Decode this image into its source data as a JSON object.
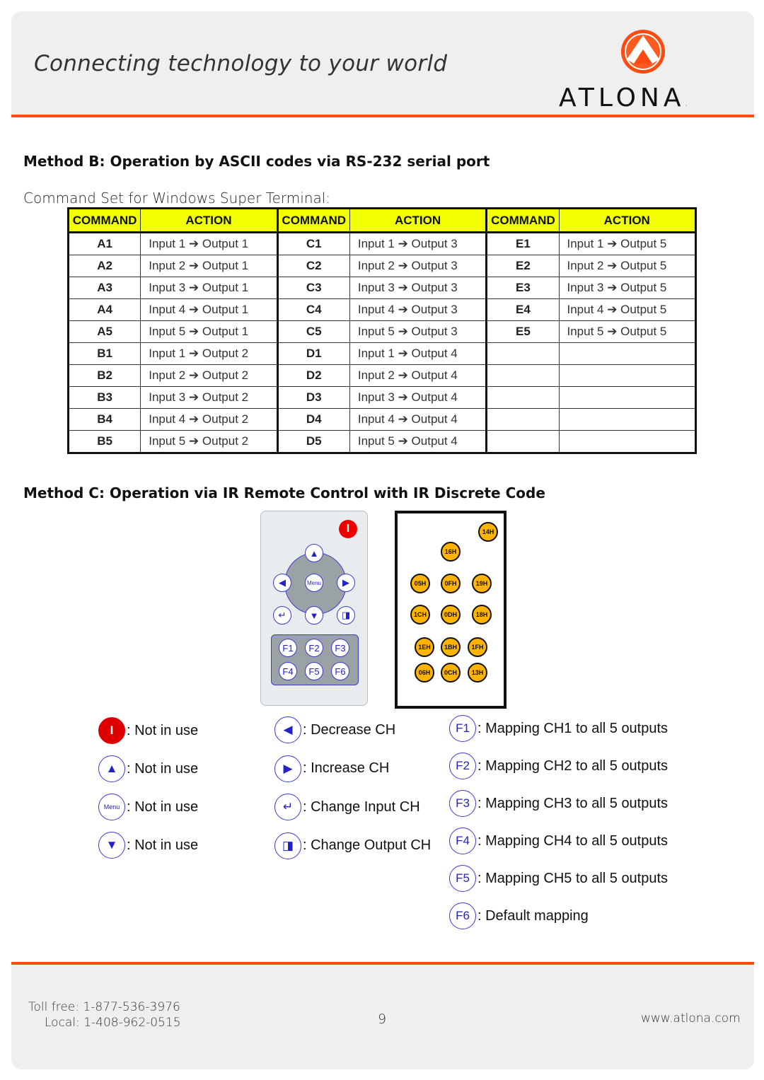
{
  "header": {
    "tagline": "Connecting technology to your world",
    "brand": "ATLONA",
    "brand_suffix": ".",
    "accent_color": "#ff4a12"
  },
  "method_b": {
    "title": "Method B: Operation by ASCII codes via RS-232 serial port",
    "subtitle": "Command Set for Windows Super Terminal:",
    "headers": [
      "COMMAND",
      "ACTION",
      "COMMAND",
      "ACTION",
      "COMMAND",
      "ACTION"
    ],
    "rows": [
      [
        "A1",
        "Input 1 ➔ Output 1",
        "C1",
        "Input 1 ➔ Output 3",
        "E1",
        "Input 1 ➔ Output 5"
      ],
      [
        "A2",
        "Input 2 ➔ Output 1",
        "C2",
        "Input 2 ➔ Output 3",
        "E2",
        "Input 2 ➔ Output 5"
      ],
      [
        "A3",
        "Input 3 ➔ Output 1",
        "C3",
        "Input 3 ➔ Output 3",
        "E3",
        "Input 3 ➔ Output 5"
      ],
      [
        "A4",
        "Input 4 ➔ Output 1",
        "C4",
        "Input 4 ➔ Output 3",
        "E4",
        "Input 4 ➔ Output 5"
      ],
      [
        "A5",
        "Input 5 ➔ Output 1",
        "C5",
        "Input 5 ➔ Output 3",
        "E5",
        "Input 5 ➔ Output 5"
      ],
      [
        "B1",
        "Input 1 ➔ Output 2",
        "D1",
        "Input 1 ➔ Output 4",
        "",
        ""
      ],
      [
        "B2",
        "Input 2 ➔ Output 2",
        "D2",
        "Input 2 ➔ Output 4",
        "",
        ""
      ],
      [
        "B3",
        "Input 3 ➔ Output 2",
        "D3",
        "Input 3 ➔ Output 4",
        "",
        ""
      ],
      [
        "B4",
        "Input 4 ➔ Output 2",
        "D4",
        "Input 4 ➔ Output 4",
        "",
        ""
      ],
      [
        "B5",
        "Input 5 ➔ Output 2",
        "D5",
        "Input 5 ➔ Output 4",
        "",
        ""
      ]
    ],
    "header_color": "#f2ff00"
  },
  "method_c": {
    "title": "Method C: Operation via IR Remote Control with IR Discrete Code",
    "remote_buttons": {
      "power": "I",
      "menu": "Menu",
      "f_keys": [
        "F1",
        "F2",
        "F3",
        "F4",
        "F5",
        "F6"
      ]
    },
    "ir_codes": [
      "14H",
      "16H",
      "05H",
      "0FH",
      "19H",
      "1CH",
      "0DH",
      "18H",
      "1EH",
      "1BH",
      "1FH",
      "06H",
      "0CH",
      "13H"
    ],
    "legend_left": [
      {
        "icon": "power-icon",
        "glyph": "I",
        "label": ": Not in use"
      },
      {
        "icon": "up-arrow-icon",
        "glyph": "▲",
        "label": ": Not in use"
      },
      {
        "icon": "menu-icon",
        "glyph": "Menu",
        "label": ": Not in use"
      },
      {
        "icon": "down-arrow-icon",
        "glyph": "▼",
        "label": ": Not in use"
      }
    ],
    "legend_mid": [
      {
        "icon": "left-arrow-icon",
        "glyph": "◀",
        "label": ": Decrease CH"
      },
      {
        "icon": "right-arrow-icon",
        "glyph": "▶",
        "label": ": Increase CH"
      },
      {
        "icon": "enter-icon",
        "glyph": "↵",
        "label": ": Change Input CH"
      },
      {
        "icon": "output-icon",
        "glyph": "◨",
        "label": ": Change Output CH"
      }
    ],
    "legend_right": [
      {
        "icon": "f1-icon",
        "glyph": "F1",
        "label": ": Mapping CH1 to all 5 outputs"
      },
      {
        "icon": "f2-icon",
        "glyph": "F2",
        "label": ": Mapping CH2 to all 5 outputs"
      },
      {
        "icon": "f3-icon",
        "glyph": "F3",
        "label": ": Mapping CH3 to all 5 outputs"
      },
      {
        "icon": "f4-icon",
        "glyph": "F4",
        "label": ": Mapping CH4 to all 5 outputs"
      },
      {
        "icon": "f5-icon",
        "glyph": "F5",
        "label": ": Mapping CH5 to all 5 outputs"
      },
      {
        "icon": "f6-icon",
        "glyph": "F6",
        "label": ": Default mapping"
      }
    ]
  },
  "footer": {
    "toll_free": "Toll free: 1-877-536-3976",
    "local": "Local: 1-408-962-0515",
    "page_number": "9",
    "website": "www.atlona.com"
  }
}
